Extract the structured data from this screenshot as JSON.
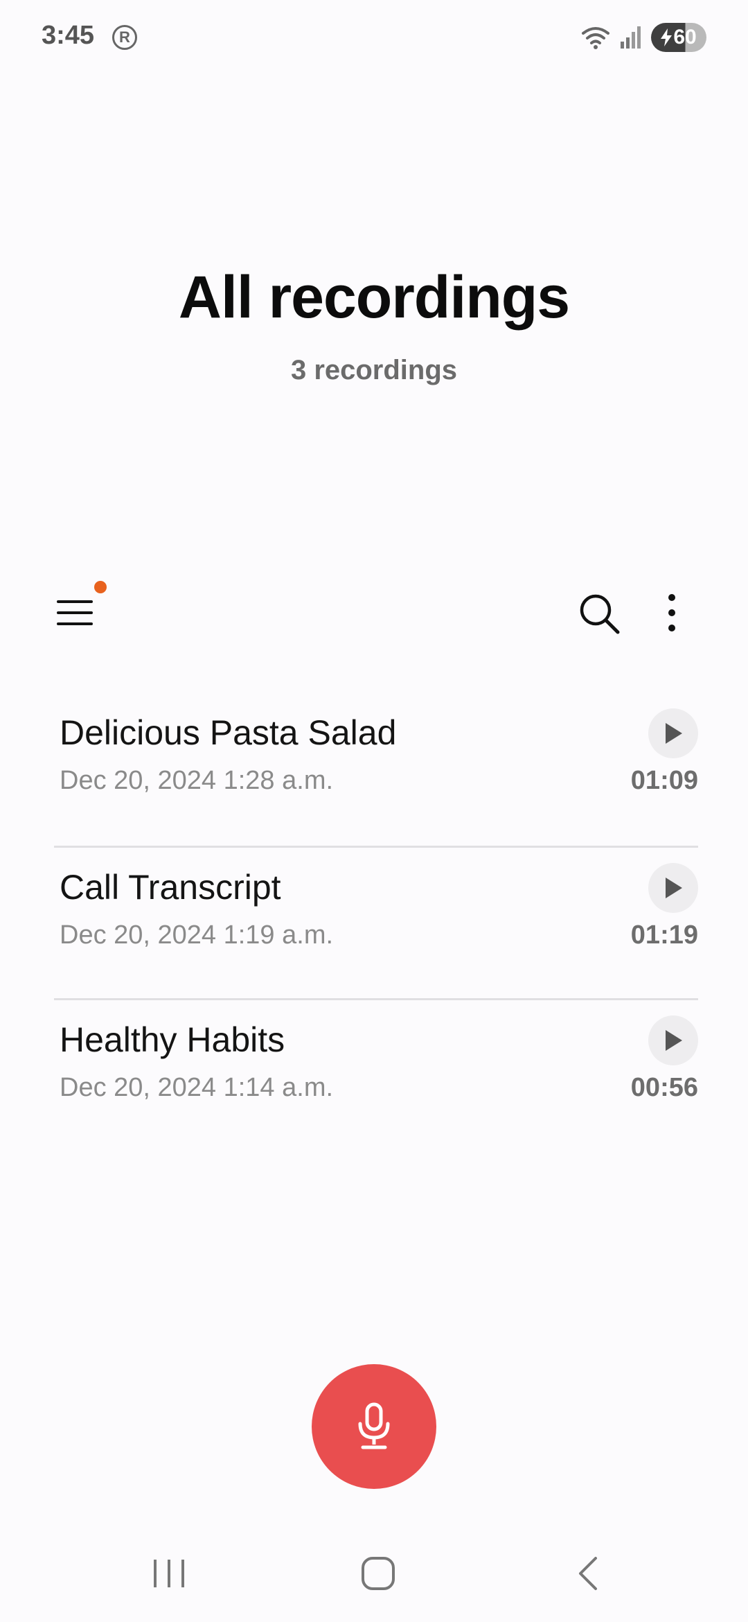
{
  "status_bar": {
    "time": "3:45",
    "r_badge": "R",
    "battery_level": "60"
  },
  "header": {
    "title": "All recordings",
    "subtitle": "3 recordings"
  },
  "recordings": [
    {
      "name": "Delicious Pasta Salad",
      "date": "Dec 20, 2024 1:28 a.m.",
      "duration": "01:09"
    },
    {
      "name": "Call Transcript",
      "date": "Dec 20, 2024 1:19 a.m.",
      "duration": "01:19"
    },
    {
      "name": "Healthy Habits",
      "date": "Dec 20, 2024 1:14 a.m.",
      "duration": "00:56"
    }
  ],
  "icons": {
    "menu": "menu-icon",
    "search": "search-icon",
    "more": "more-vert-icon",
    "play": "play-icon",
    "mic": "microphone-icon"
  },
  "colors": {
    "record_button": "#e94e4f",
    "notification_dot": "#e8621e",
    "background": "#fcfbfd"
  }
}
